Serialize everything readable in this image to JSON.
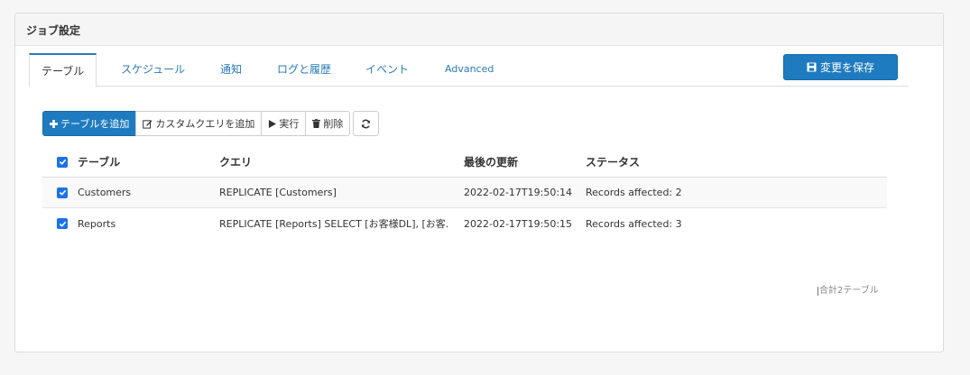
{
  "panel": {
    "title": "ジョブ設定"
  },
  "tabs": [
    {
      "label": "テーブル"
    },
    {
      "label": "スケジュール"
    },
    {
      "label": "通知"
    },
    {
      "label": "ログと履歴"
    },
    {
      "label": "イベント"
    },
    {
      "label": "Advanced"
    }
  ],
  "save_button": {
    "label": "変更を保存",
    "icon": "save-icon"
  },
  "toolbar": {
    "add_table": {
      "label": "テーブルを追加",
      "icon": "plus-icon"
    },
    "add_query": {
      "label": "カスタムクエリを追加",
      "icon": "edit-icon"
    },
    "run": {
      "label": "実行",
      "icon": "play-icon"
    },
    "delete": {
      "label": "削除",
      "icon": "trash-icon"
    },
    "refresh": {
      "icon": "refresh-icon"
    }
  },
  "table": {
    "columns": [
      "テーブル",
      "クエリ",
      "最後の更新",
      "ステータス"
    ],
    "rows": [
      {
        "table": "Customers",
        "query": "REPLICATE [Customers]",
        "updated": "2022-02-17T19:50:14",
        "status": "Records affected: 2",
        "checked": true
      },
      {
        "table": "Reports",
        "query": "REPLICATE [Reports] SELECT [お客様DL], [お客...",
        "updated": "2022-02-17T19:50:15",
        "status": "Records affected: 3",
        "checked": true
      }
    ],
    "footer": "合計2テーブル"
  },
  "colors": {
    "accent": "#1f7bbf",
    "checkbox": "#1a73e8"
  }
}
